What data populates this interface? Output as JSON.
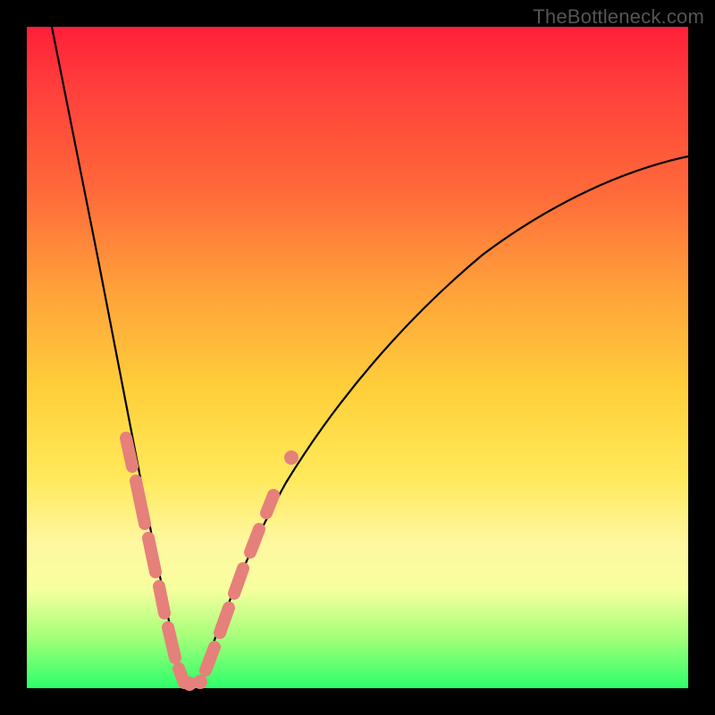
{
  "watermark": "TheBottleneck.com",
  "colors": {
    "background_frame": "#000000",
    "gradient_stops": [
      "#ff1f3a",
      "#ff3b3b",
      "#ff6a3a",
      "#ffa23a",
      "#ffd03a",
      "#ffe95a",
      "#fff7a0",
      "#f7ff9e",
      "#a8ff7a",
      "#2dff6a"
    ],
    "curve": "#000000",
    "markers": "#e6807a"
  },
  "chart_data": {
    "type": "line",
    "title": "",
    "xlabel": "",
    "ylabel": "",
    "xlim": [
      0,
      100
    ],
    "ylim": [
      0,
      100
    ],
    "grid": false,
    "legend": false,
    "description": "V-shaped bottleneck curve on a red-to-green vertical gradient; minimum (0% bottleneck) near x≈23. Left branch falls steeply from top-left corner to the minimum; right branch rises with diminishing slope toward the top-right. Salmon-colored capsule markers cluster along both branches near the trough (~y 5–30).",
    "series": [
      {
        "name": "left_branch",
        "x": [
          4,
          6,
          8,
          10,
          12,
          14,
          16,
          18,
          20,
          22,
          23
        ],
        "y": [
          100,
          90,
          79,
          68,
          57,
          46,
          36,
          26,
          16,
          6,
          1
        ]
      },
      {
        "name": "right_branch",
        "x": [
          23,
          26,
          30,
          35,
          40,
          46,
          53,
          61,
          70,
          80,
          90,
          100
        ],
        "y": [
          1,
          6,
          14,
          23,
          31,
          39,
          47,
          55,
          62,
          69,
          75,
          80
        ]
      }
    ],
    "markers": [
      {
        "branch": "left",
        "x_range": [
          14,
          23
        ],
        "y_range": [
          1,
          35
        ],
        "style": "capsule"
      },
      {
        "branch": "right",
        "x_range": [
          23,
          35
        ],
        "y_range": [
          1,
          30
        ],
        "style": "capsule"
      }
    ],
    "minimum": {
      "x": 23,
      "y": 1
    }
  }
}
